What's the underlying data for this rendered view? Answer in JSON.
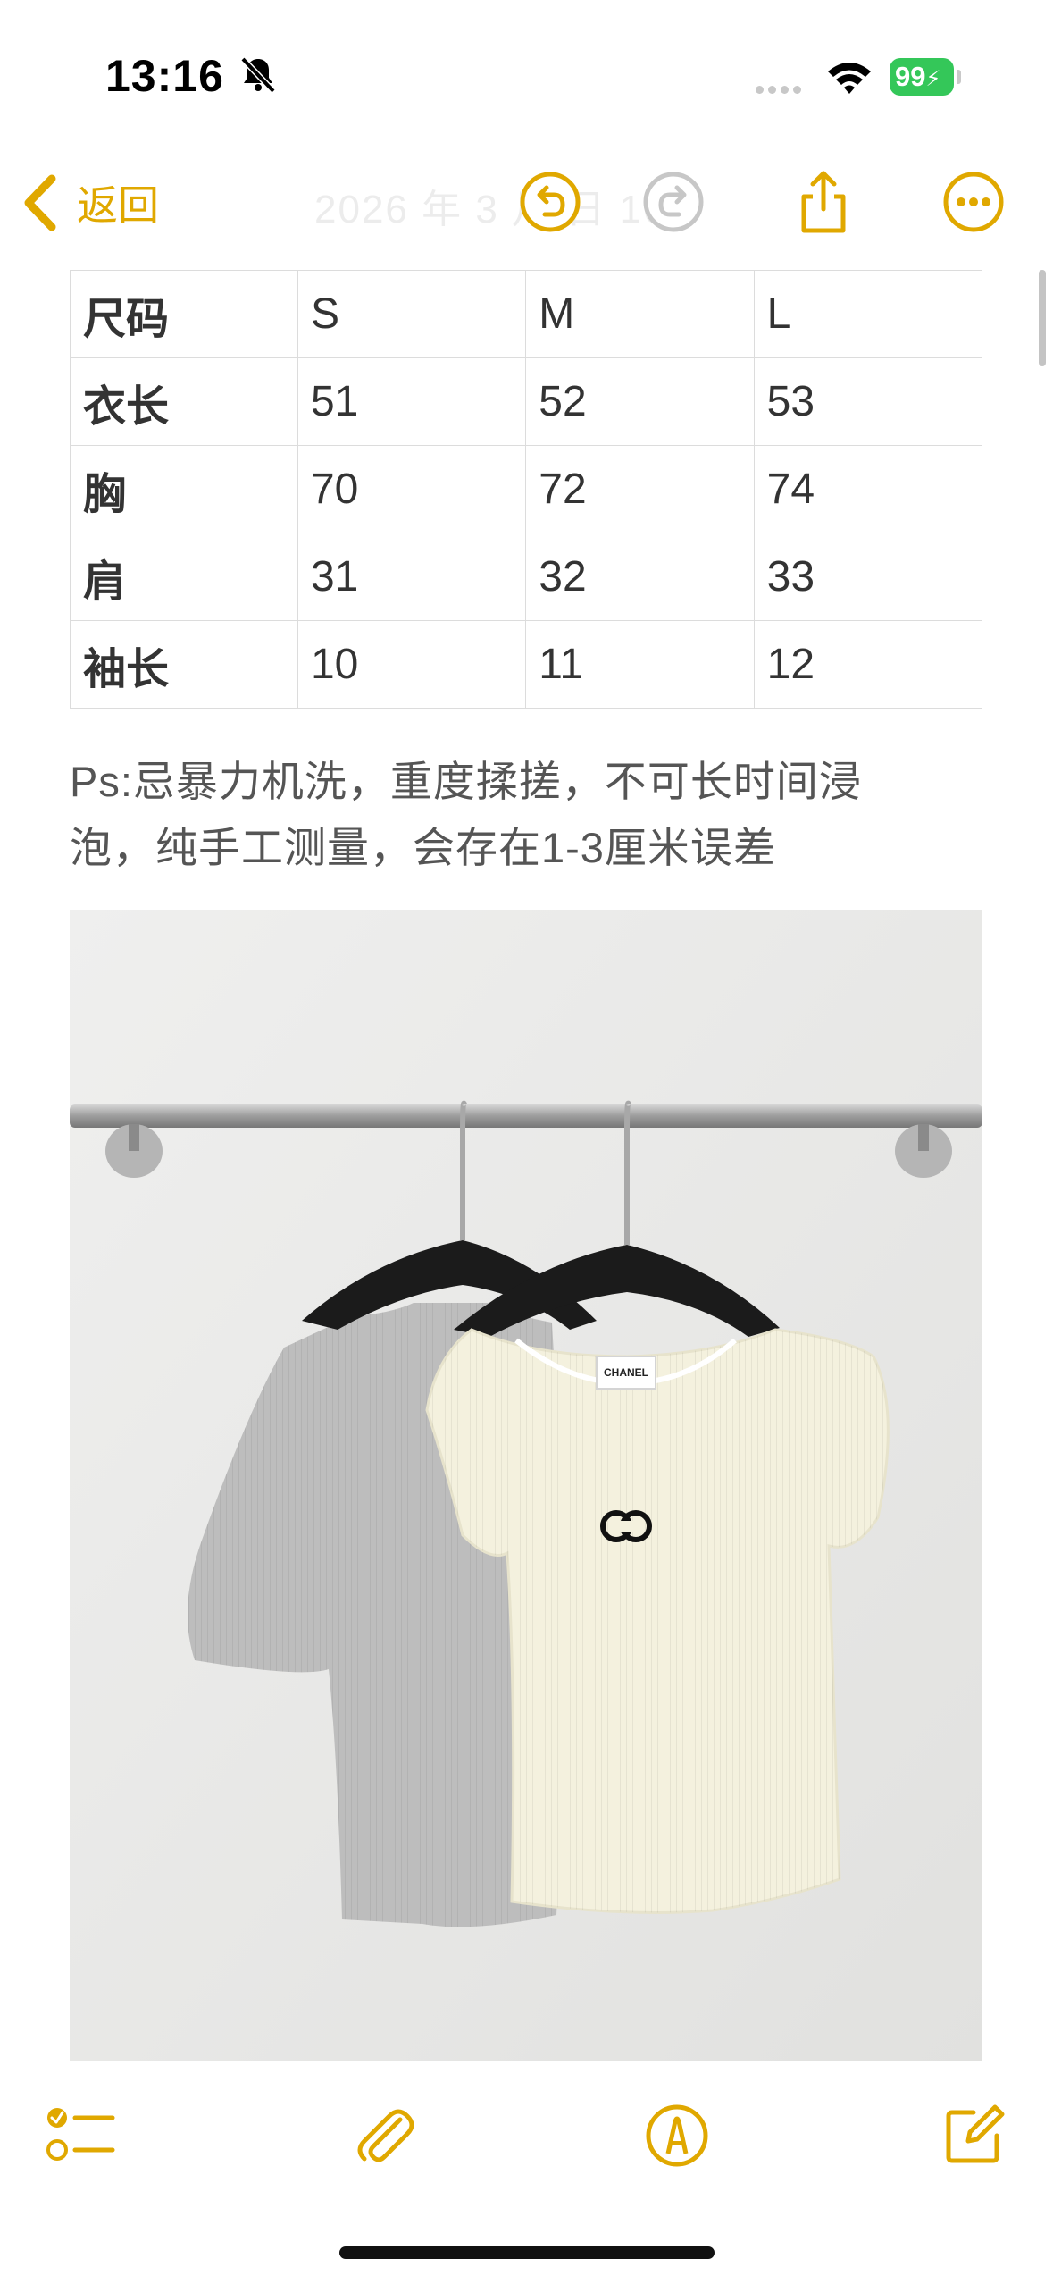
{
  "status_bar": {
    "time": "13:16",
    "battery": "99",
    "icons": [
      "bell-slash-icon",
      "signal-icon",
      "wifi-icon",
      "battery-charging-icon"
    ]
  },
  "nav": {
    "back_label": "返回",
    "faded_title": "2026 年 3 月  日 16",
    "icons": [
      "chevron-left-icon",
      "undo-icon",
      "redo-icon",
      "share-icon",
      "more-icon"
    ]
  },
  "size_table": {
    "header": [
      "尺码",
      "S",
      "M",
      "L"
    ],
    "rows": [
      [
        "衣长",
        "51",
        "52",
        "53"
      ],
      [
        "胸",
        "70",
        "72",
        "74"
      ],
      [
        "肩",
        "31",
        "32",
        "33"
      ],
      [
        "袖长",
        "10",
        "11",
        "12"
      ]
    ]
  },
  "note": {
    "line1": "Ps:忌暴力机洗，重度揉搓，不可长时间浸",
    "line2": "泡，纯手工测量，会存在1-3厘米误差"
  },
  "photo": {
    "label_text": "CHANEL",
    "colors": {
      "wall": "#e9e9e7",
      "grey_top": "#b9b9b9",
      "cream_top": "#f4f1de",
      "hanger": "#1b1b1b",
      "rail": "#a9a9a9"
    }
  },
  "toolbar": {
    "icons": [
      "checklist-icon",
      "paperclip-icon",
      "markup-pen-icon",
      "compose-icon"
    ]
  },
  "colors": {
    "accent": "#e0a800",
    "battery": "#34c759",
    "grid": "#dcdcdc"
  }
}
